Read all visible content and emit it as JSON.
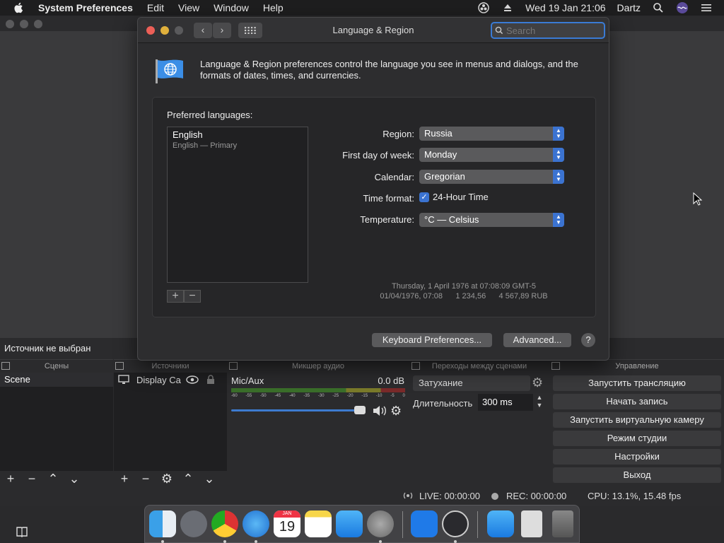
{
  "menubar": {
    "app_name": "System Preferences",
    "items": [
      "Edit",
      "View",
      "Window",
      "Help"
    ],
    "datetime": "Wed 19 Jan  21:06",
    "user": "Dartz"
  },
  "obs": {
    "source_status": "Источник не выбран",
    "panels": {
      "scenes": "Сцены",
      "sources": "Источники",
      "mixer": "Микшер аудио",
      "transitions": "Переходы между сценами",
      "controls": "Управление"
    },
    "scene_item": "Scene",
    "source_item": "Display Ca",
    "mixer": {
      "channel": "Mic/Aux",
      "level": "0.0 dB",
      "ticks": [
        "-60",
        "-55",
        "-50",
        "-45",
        "-40",
        "-35",
        "-30",
        "-25",
        "-20",
        "-15",
        "-10",
        "-5",
        "0"
      ]
    },
    "transition": {
      "selected": "Затухание",
      "duration_label": "Длительность",
      "duration_value": "300 ms"
    },
    "controls": [
      "Запустить трансляцию",
      "Начать запись",
      "Запустить виртуальную камеру",
      "Режим студии",
      "Настройки",
      "Выход"
    ],
    "status": {
      "live": "LIVE: 00:00:00",
      "rec": "REC: 00:00:00",
      "cpu": "CPU: 13.1%, 15.48 fps"
    }
  },
  "lang_region": {
    "title": "Language & Region",
    "search_placeholder": "Search",
    "intro": "Language & Region preferences control the language you see in menus and dialogs, and the formats of dates, times, and currencies.",
    "preferred_label": "Preferred languages:",
    "language": {
      "name": "English",
      "detail": "English — Primary"
    },
    "region_label": "Region:",
    "region_value": "Russia",
    "firstday_label": "First day of week:",
    "firstday_value": "Monday",
    "calendar_label": "Calendar:",
    "calendar_value": "Gregorian",
    "timeformat_label": "Time format:",
    "timeformat_value": "24-Hour Time",
    "temperature_label": "Temperature:",
    "temperature_value": "°C — Celsius",
    "sample_line1": "Thursday, 1 April 1976 at 07:08:09 GMT-5",
    "sample_line2": "01/04/1976, 07:08      1 234,56      4 567,89 RUB",
    "keyboard_button": "Keyboard Preferences...",
    "advanced_button": "Advanced...",
    "help_button": "?"
  },
  "dock": {
    "calendar_month": "JAN",
    "calendar_day": "19"
  }
}
